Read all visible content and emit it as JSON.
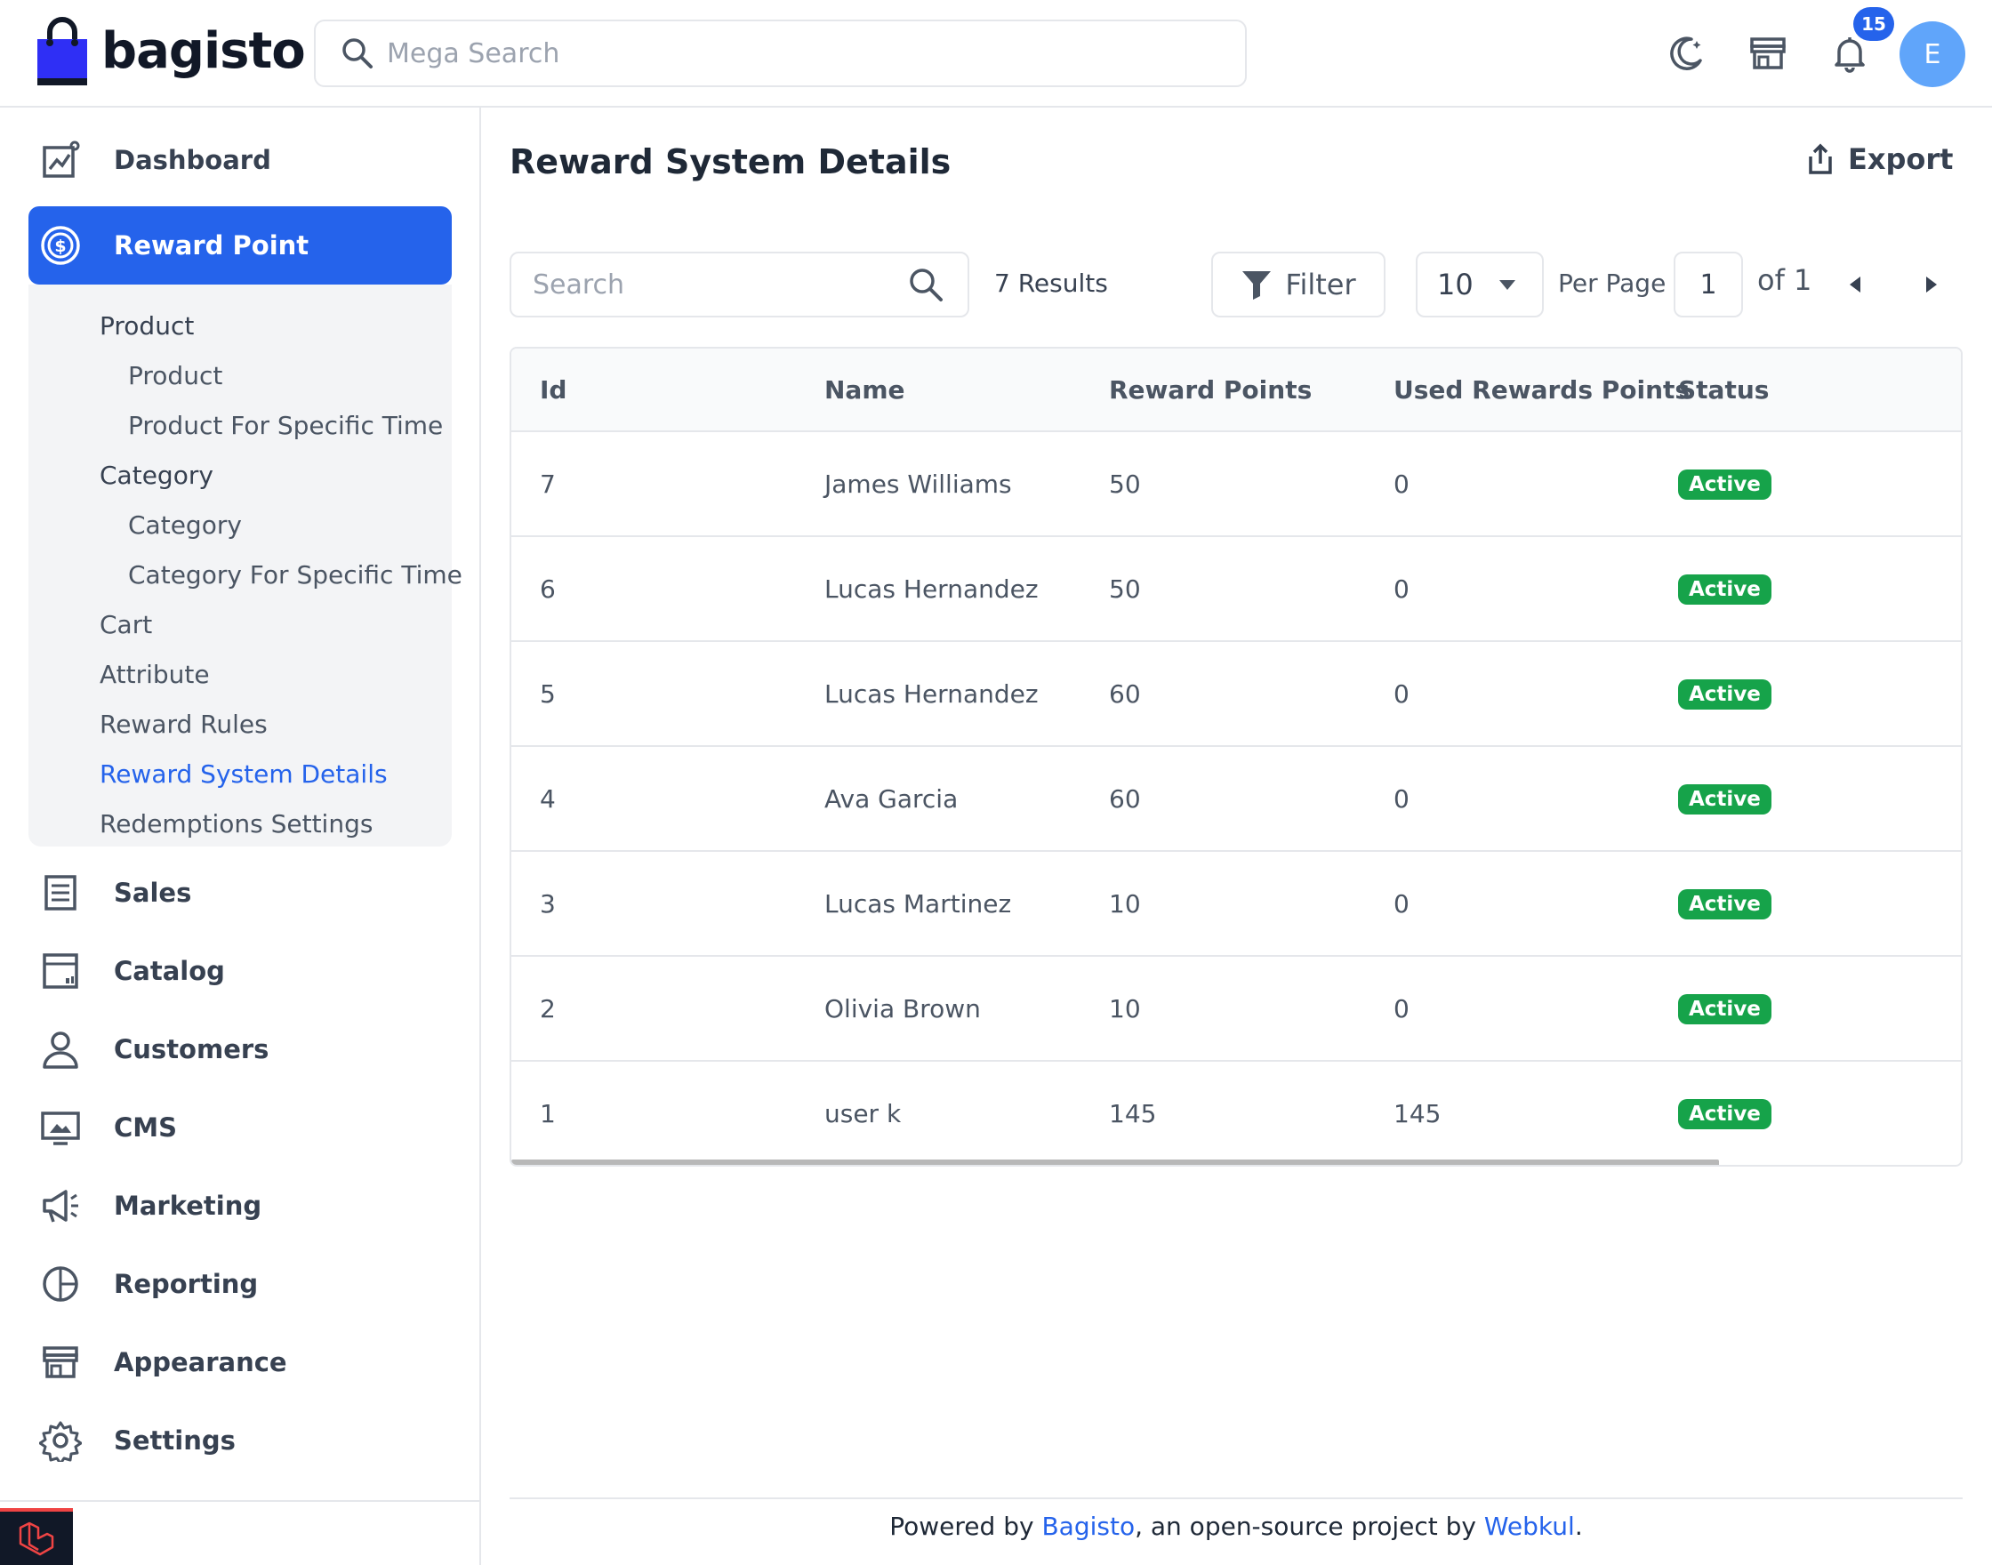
{
  "brand": {
    "name": "bagisto"
  },
  "header": {
    "search_placeholder": "Mega Search",
    "notification_count": "15",
    "avatar_initial": "E"
  },
  "sidebar": {
    "items": [
      {
        "label": "Dashboard",
        "icon": "dashboard-icon"
      },
      {
        "label": "Reward Point",
        "icon": "reward-point-icon"
      },
      {
        "label": "Sales",
        "icon": "sales-icon"
      },
      {
        "label": "Catalog",
        "icon": "catalog-icon"
      },
      {
        "label": "Customers",
        "icon": "customers-icon"
      },
      {
        "label": "CMS",
        "icon": "cms-icon"
      },
      {
        "label": "Marketing",
        "icon": "marketing-icon"
      },
      {
        "label": "Reporting",
        "icon": "reporting-icon"
      },
      {
        "label": "Appearance",
        "icon": "appearance-icon"
      },
      {
        "label": "Settings",
        "icon": "settings-icon"
      }
    ],
    "submenu": [
      {
        "label": "Product"
      },
      {
        "label": "Product"
      },
      {
        "label": "Product For Specific Time"
      },
      {
        "label": "Category"
      },
      {
        "label": "Category"
      },
      {
        "label": "Category For Specific Time"
      },
      {
        "label": "Cart"
      },
      {
        "label": "Attribute"
      },
      {
        "label": "Reward Rules"
      },
      {
        "label": "Reward System Details"
      },
      {
        "label": "Redemptions Settings"
      }
    ]
  },
  "main": {
    "title": "Reward System Details",
    "export_label": "Export",
    "search_placeholder": "Search",
    "results_text": "7 Results",
    "filter_label": "Filter",
    "per_page_value": "10",
    "per_page_label": "Per Page",
    "current_page": "1",
    "of_pages": "of 1"
  },
  "table": {
    "columns": [
      "Id",
      "Name",
      "Reward Points",
      "Used Rewards Points",
      "Status"
    ],
    "rows": [
      {
        "id": "7",
        "name": "James Williams",
        "reward_points": "50",
        "used_points": "0",
        "status": "Active"
      },
      {
        "id": "6",
        "name": "Lucas Hernandez",
        "reward_points": "50",
        "used_points": "0",
        "status": "Active"
      },
      {
        "id": "5",
        "name": "Lucas Hernandez",
        "reward_points": "60",
        "used_points": "0",
        "status": "Active"
      },
      {
        "id": "4",
        "name": "Ava Garcia",
        "reward_points": "60",
        "used_points": "0",
        "status": "Active"
      },
      {
        "id": "3",
        "name": "Lucas Martinez",
        "reward_points": "10",
        "used_points": "0",
        "status": "Active"
      },
      {
        "id": "2",
        "name": "Olivia Brown",
        "reward_points": "10",
        "used_points": "0",
        "status": "Active"
      },
      {
        "id": "1",
        "name": "user k",
        "reward_points": "145",
        "used_points": "145",
        "status": "Active"
      }
    ]
  },
  "footer": {
    "prefix": "Powered by ",
    "bagisto_link": "Bagisto",
    "middle": ", an open-source project by ",
    "webkul_link": "Webkul",
    "suffix": "."
  },
  "colors": {
    "accent": "#2563eb",
    "active_badge": "#16a34a",
    "avatar": "#60a5fa"
  }
}
